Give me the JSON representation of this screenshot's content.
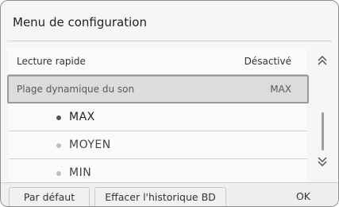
{
  "window": {
    "title": "Menu de configuration"
  },
  "rows": [
    {
      "label": "Lecture rapide",
      "value": "Désactivé"
    },
    {
      "label": "Plage dynamique du son",
      "value": "MAX"
    }
  ],
  "options": [
    {
      "label": "MAX",
      "selected": true
    },
    {
      "label": "MOYEN",
      "selected": false
    },
    {
      "label": "MIN",
      "selected": false
    }
  ],
  "scroll": {
    "up_icon": "chevron-double-up",
    "down_icon": "chevron-double-down"
  },
  "buttons": {
    "default": "Par défaut",
    "clear_history": "Effacer l'historique BD",
    "ok": "OK"
  }
}
